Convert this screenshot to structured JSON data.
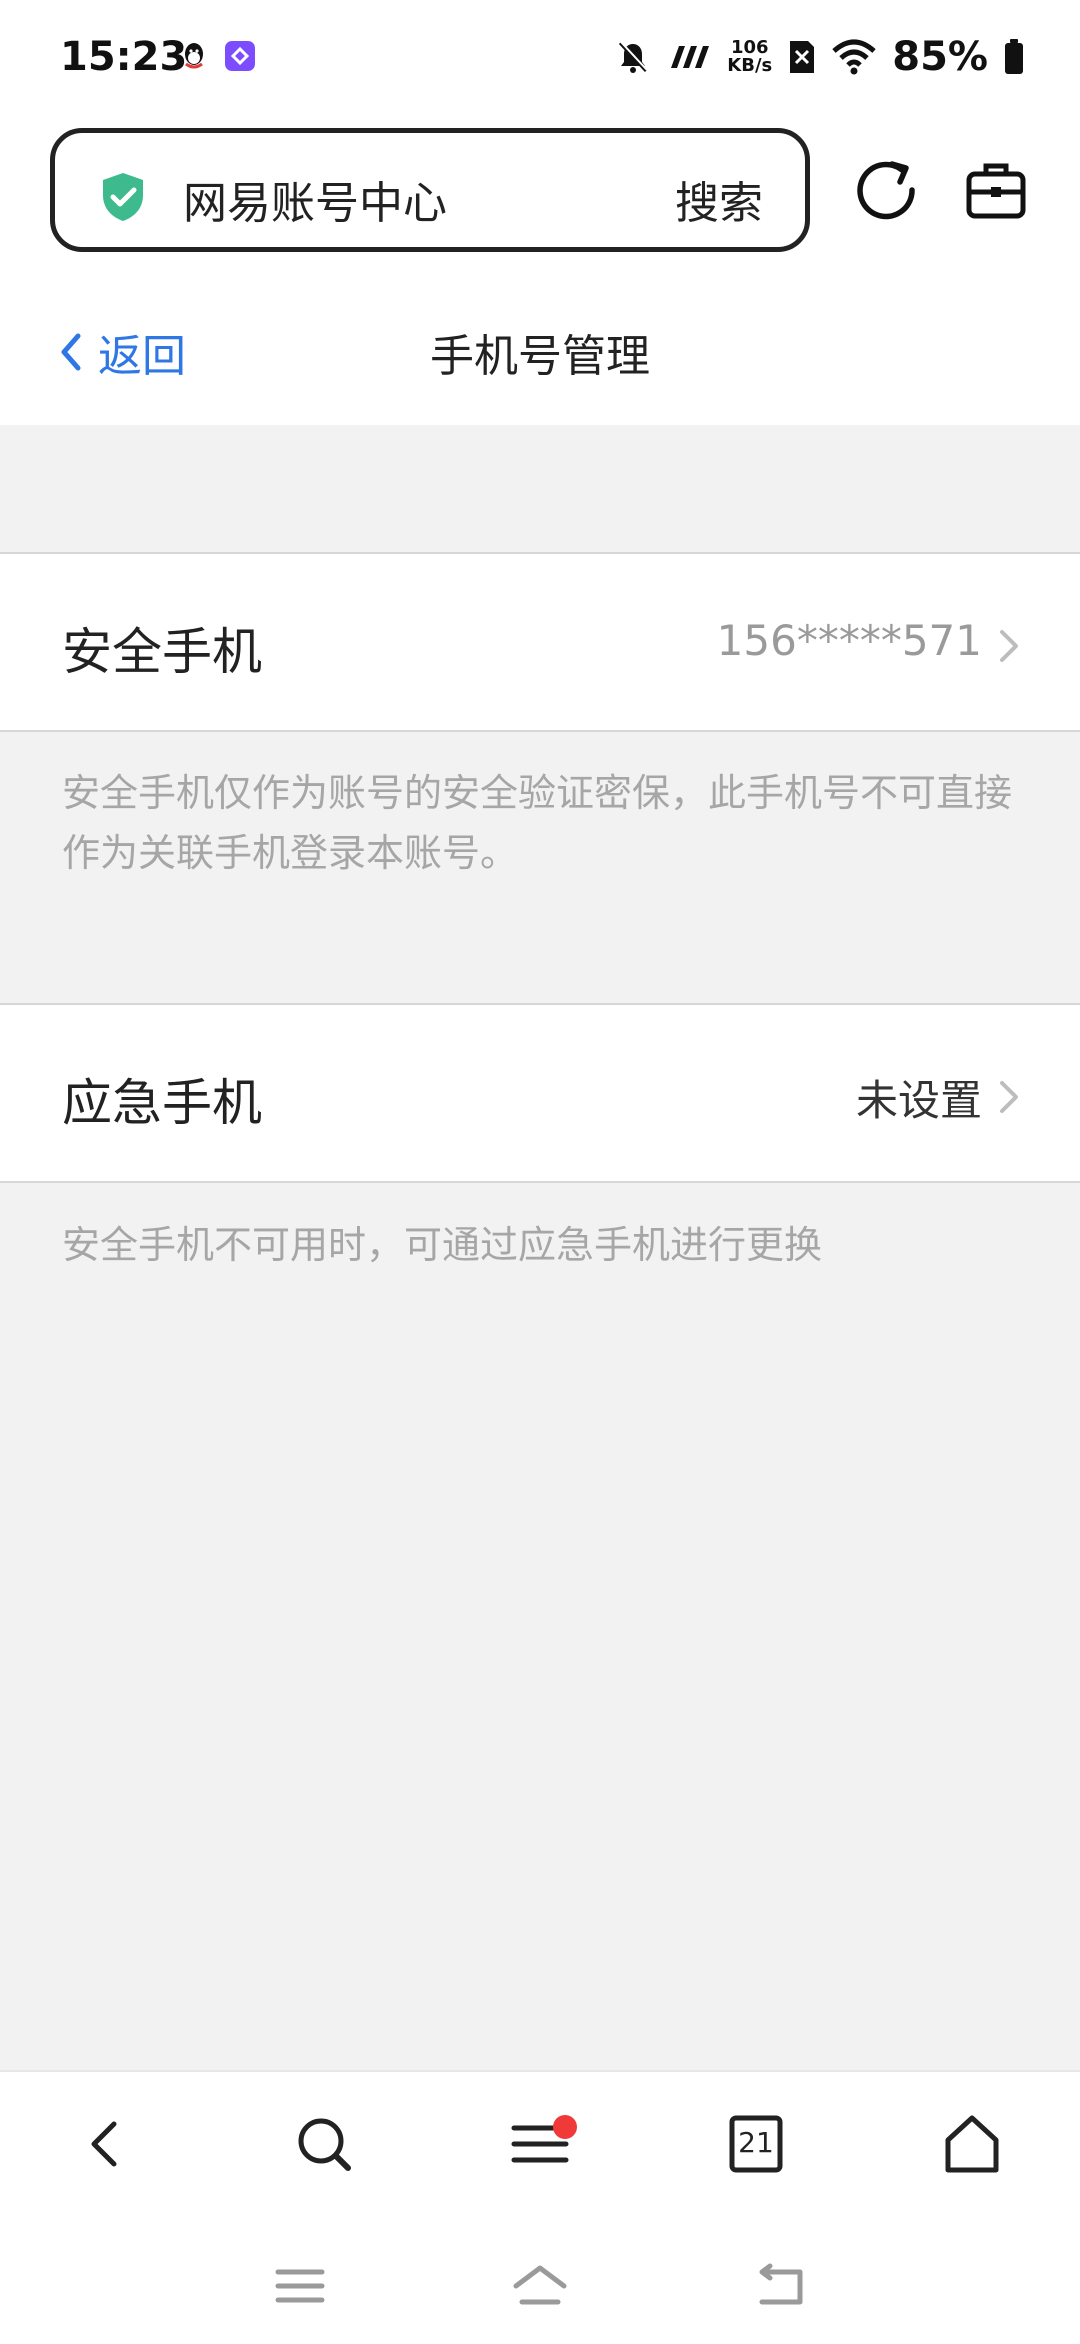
{
  "status_bar": {
    "time": "15:23",
    "net_speed_value": "106",
    "net_speed_unit": "KB/s",
    "battery": "85%",
    "icons": [
      "qq-icon",
      "app-icon",
      "mute-icon",
      "signal-icon",
      "no-sim-icon",
      "wifi-icon",
      "battery-icon"
    ]
  },
  "toolbar": {
    "site_name": "网易账号中心",
    "search_label": "搜索",
    "icons": [
      "shield-check-icon",
      "refresh-icon",
      "toolbox-icon"
    ]
  },
  "header": {
    "back_label": "返回",
    "title": "手机号管理"
  },
  "rows": [
    {
      "label": "安全手机",
      "value": "156*****571",
      "note": "安全手机仅作为账号的安全验证密保，此手机号不可直接作为关联手机登录本账号。"
    },
    {
      "label": "应急手机",
      "value": "未设置",
      "note": "安全手机不可用时，可通过应急手机进行更换"
    }
  ],
  "bottom_nav": {
    "tab_count": "21",
    "icons": [
      "back-icon",
      "search-icon",
      "menu-icon",
      "tabs-icon",
      "home-icon"
    ]
  },
  "colors": {
    "accent": "#2f77e5",
    "shield": "#3dbb8f",
    "badge_red": "#f03a3a",
    "background": "#f2f2f2",
    "note_text": "#a6a6a6"
  }
}
